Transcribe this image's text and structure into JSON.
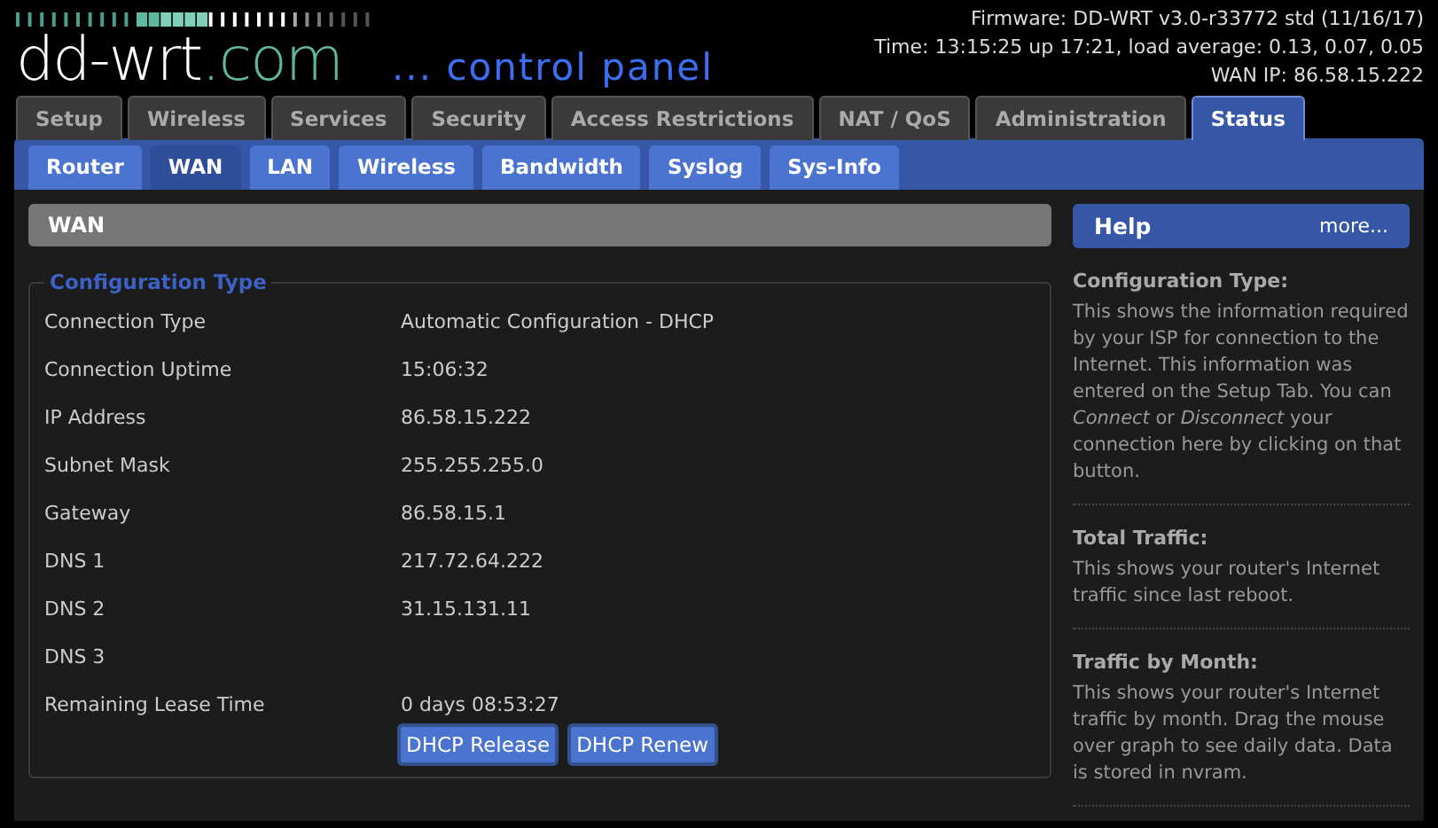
{
  "logo": {
    "name": "dd-wrt",
    "domain": ".com",
    "tagline": "... control panel"
  },
  "header_info": [
    "Firmware: DD-WRT v3.0-r33772 std (11/16/17)",
    "Time: 13:15:25 up 17:21, load average: 0.13, 0.07, 0.05",
    "WAN IP: 86.58.15.222"
  ],
  "tabs": [
    {
      "label": "Setup",
      "selected": false
    },
    {
      "label": "Wireless",
      "selected": false
    },
    {
      "label": "Services",
      "selected": false
    },
    {
      "label": "Security",
      "selected": false
    },
    {
      "label": "Access Restrictions",
      "selected": false
    },
    {
      "label": "NAT / QoS",
      "selected": false
    },
    {
      "label": "Administration",
      "selected": false
    },
    {
      "label": "Status",
      "selected": true
    }
  ],
  "subtabs": [
    {
      "label": "Router",
      "selected": false
    },
    {
      "label": "WAN",
      "selected": true
    },
    {
      "label": "LAN",
      "selected": false
    },
    {
      "label": "Wireless",
      "selected": false
    },
    {
      "label": "Bandwidth",
      "selected": false
    },
    {
      "label": "Syslog",
      "selected": false
    },
    {
      "label": "Sys-Info",
      "selected": false
    }
  ],
  "section": {
    "title": "WAN",
    "group": "Configuration Type",
    "rows": [
      {
        "label": "Connection Type",
        "value": "Automatic Configuration - DHCP"
      },
      {
        "label": "Connection Uptime",
        "value": "15:06:32"
      },
      {
        "label": "IP Address",
        "value": "86.58.15.222"
      },
      {
        "label": "Subnet Mask",
        "value": "255.255.255.0"
      },
      {
        "label": "Gateway",
        "value": "86.58.15.1"
      },
      {
        "label": "DNS 1",
        "value": "217.72.64.222"
      },
      {
        "label": "DNS 2",
        "value": "31.15.131.11"
      },
      {
        "label": "DNS 3"
      },
      {
        "label": "Remaining Lease Time",
        "value": "0 days 08:53:27"
      }
    ],
    "buttons": [
      "DHCP Release",
      "DHCP Renew"
    ]
  },
  "help": {
    "title": "Help",
    "more": "more...",
    "items": [
      {
        "heading": "Configuration Type:",
        "text": "This shows the information required by your ISP for connection to the Internet. This information was entered on the Setup Tab. You can *Connect* or *Disconnect* your connection here by clicking on that button."
      },
      {
        "heading": "Total Traffic:",
        "text": "This shows your router's Internet traffic since last reboot."
      },
      {
        "heading": "Traffic by Month:",
        "text": "This shows your router's Internet traffic by month. Drag the mouse over graph to see daily data. Data is stored in nvram."
      }
    ]
  }
}
